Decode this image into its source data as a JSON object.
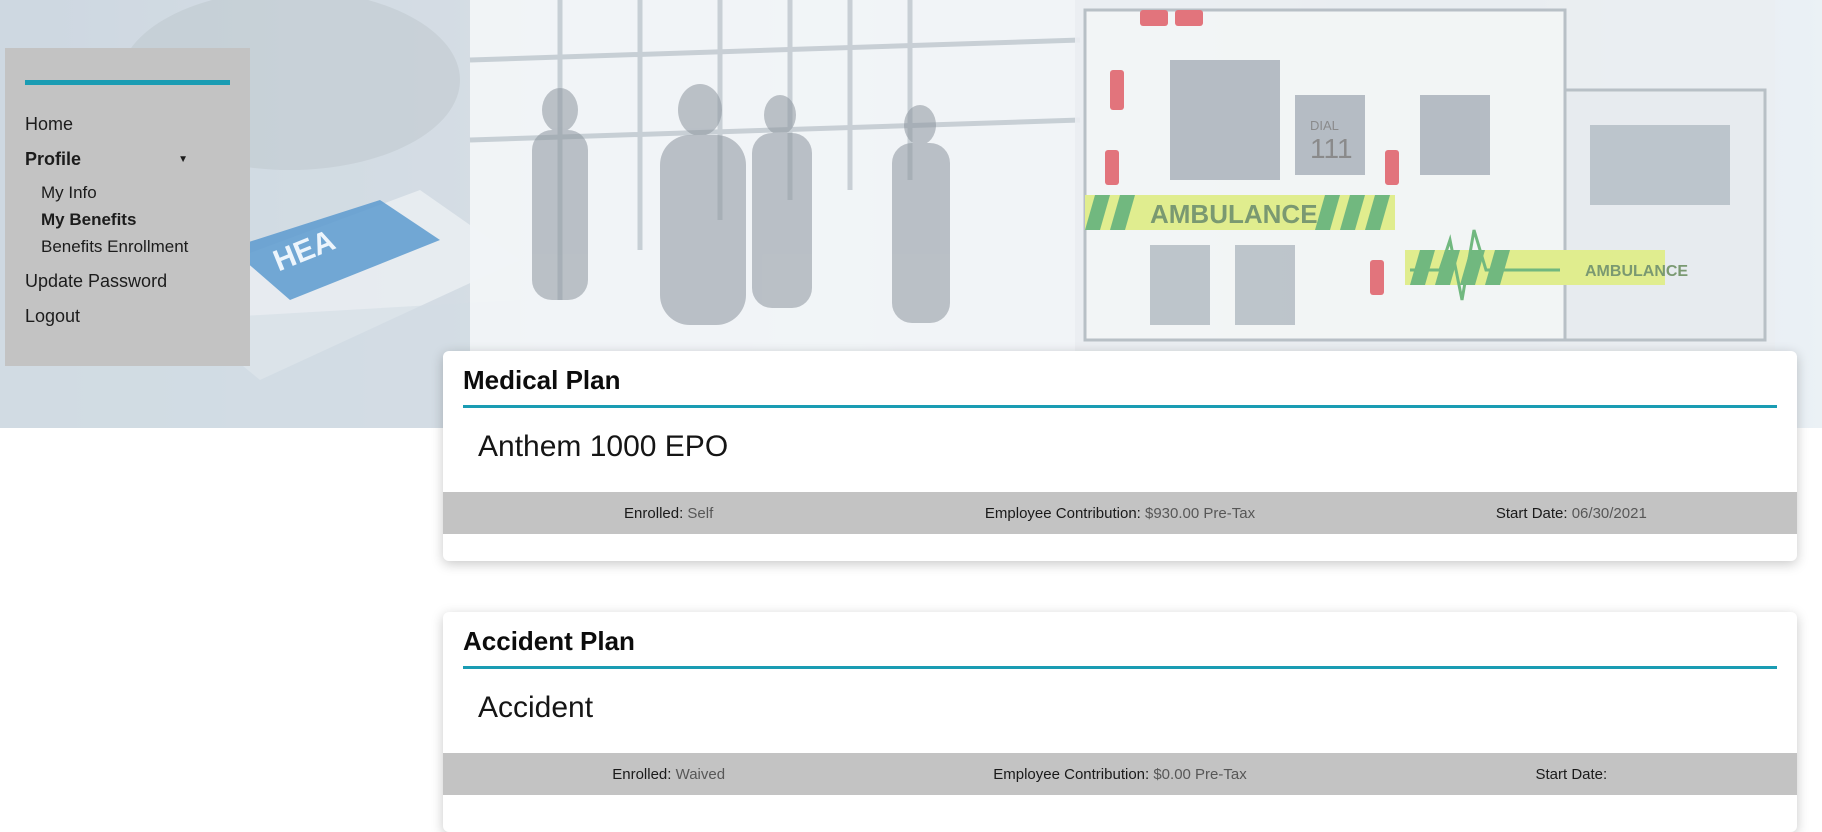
{
  "sidebar": {
    "items": {
      "home": "Home",
      "profile": "Profile",
      "profile_sub": {
        "my_info": "My Info",
        "my_benefits": "My Benefits",
        "benefits_enrollment": "Benefits Enrollment"
      },
      "update_password": "Update Password",
      "logout": "Logout"
    },
    "caret_icon": "caret-down-icon",
    "accent_color": "#1a9cb3"
  },
  "hero": {
    "ambulance_text": "AMBULANCE",
    "dial_text": "DIAL",
    "dial_number": "111",
    "folder_text": "HEA"
  },
  "plans": {
    "medical": {
      "title": "Medical Plan",
      "plan_name": "Anthem 1000 EPO",
      "enrolled_label": "Enrolled:",
      "enrolled_value": "Self",
      "contribution_label": "Employee Contribution:",
      "contribution_value": "$930.00 Pre-Tax",
      "start_label": "Start Date:",
      "start_value": "06/30/2021"
    },
    "accident": {
      "title": "Accident Plan",
      "plan_name": "Accident",
      "enrolled_label": "Enrolled:",
      "enrolled_value": "Waived",
      "contribution_label": "Employee Contribution:",
      "contribution_value": "$0.00 Pre-Tax",
      "start_label": "Start Date:",
      "start_value": ""
    }
  }
}
